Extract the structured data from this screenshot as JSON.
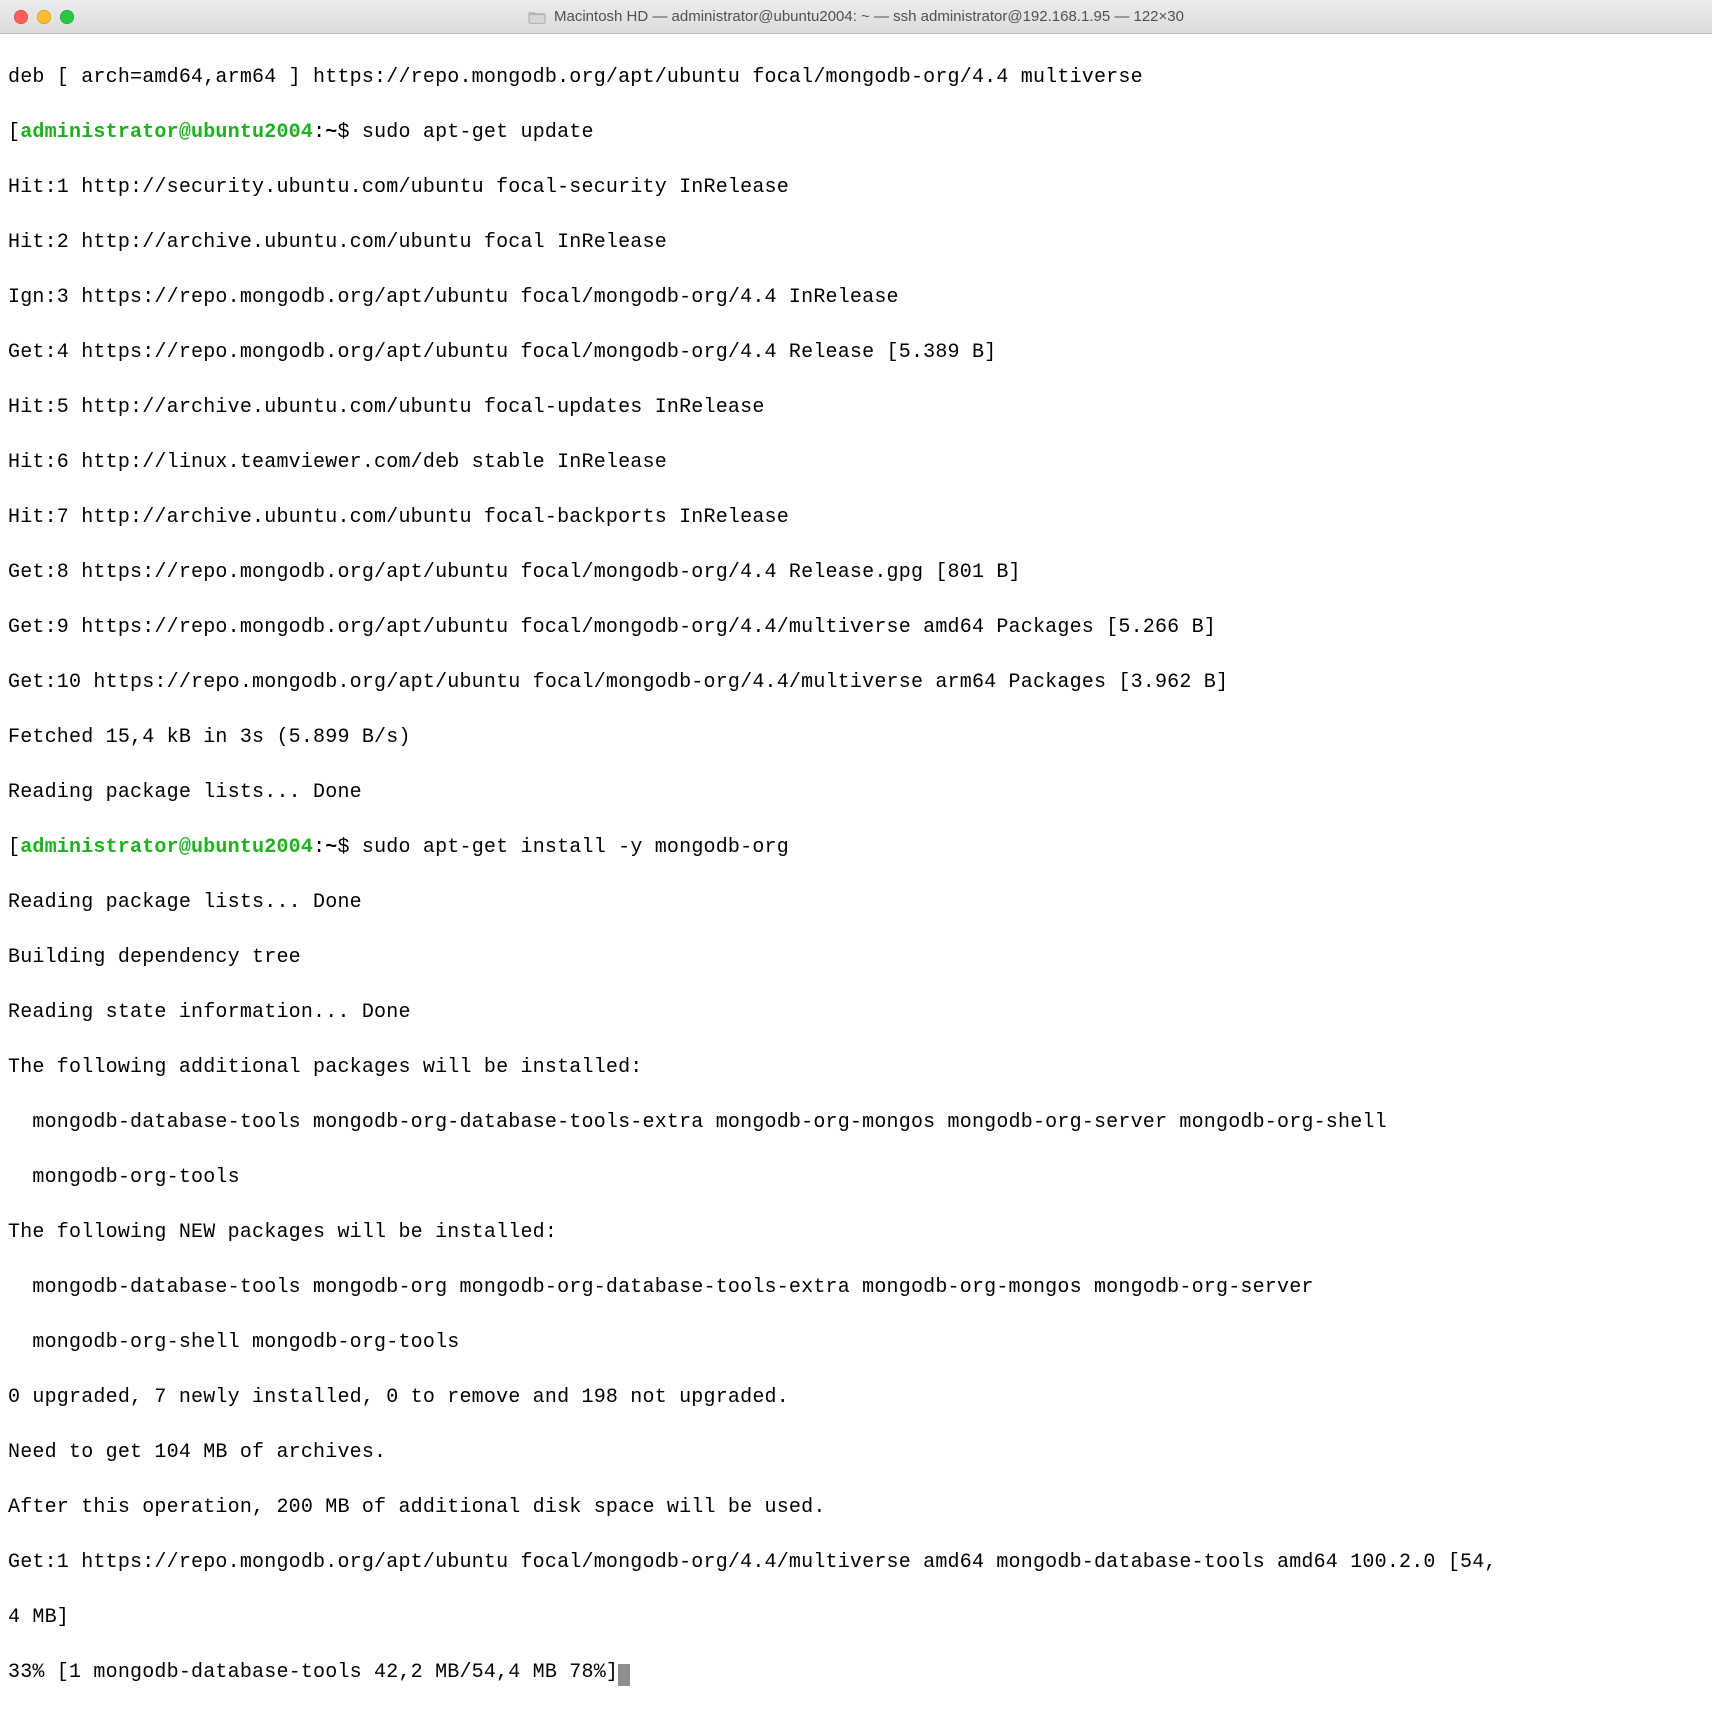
{
  "title": "Macintosh HD — administrator@ubuntu2004: ~ — ssh administrator@192.168.1.95 — 122×30",
  "prompt_user_host": "administrator@ubuntu2004",
  "prompt_sep": ":",
  "prompt_path": "~",
  "prompt_dollar": "$ ",
  "deb_line": "deb [ arch=amd64,arm64 ] https://repo.mongodb.org/apt/ubuntu focal/mongodb-org/4.4 multiverse",
  "cmd_update": "sudo apt-get update",
  "update_lines": [
    "Hit:1 http://security.ubuntu.com/ubuntu focal-security InRelease",
    "Hit:2 http://archive.ubuntu.com/ubuntu focal InRelease",
    "Ign:3 https://repo.mongodb.org/apt/ubuntu focal/mongodb-org/4.4 InRelease",
    "Get:4 https://repo.mongodb.org/apt/ubuntu focal/mongodb-org/4.4 Release [5.389 B]",
    "Hit:5 http://archive.ubuntu.com/ubuntu focal-updates InRelease",
    "Hit:6 http://linux.teamviewer.com/deb stable InRelease",
    "Hit:7 http://archive.ubuntu.com/ubuntu focal-backports InRelease",
    "Get:8 https://repo.mongodb.org/apt/ubuntu focal/mongodb-org/4.4 Release.gpg [801 B]",
    "Get:9 https://repo.mongodb.org/apt/ubuntu focal/mongodb-org/4.4/multiverse amd64 Packages [5.266 B]",
    "Get:10 https://repo.mongodb.org/apt/ubuntu focal/mongodb-org/4.4/multiverse arm64 Packages [3.962 B]",
    "Fetched 15,4 kB in 3s (5.899 B/s)",
    "Reading package lists... Done"
  ],
  "cmd_install": "sudo apt-get install -y mongodb-org",
  "install_lines": [
    "Reading package lists... Done",
    "Building dependency tree",
    "Reading state information... Done",
    "The following additional packages will be installed:",
    "  mongodb-database-tools mongodb-org-database-tools-extra mongodb-org-mongos mongodb-org-server mongodb-org-shell",
    "  mongodb-org-tools",
    "The following NEW packages will be installed:",
    "  mongodb-database-tools mongodb-org mongodb-org-database-tools-extra mongodb-org-mongos mongodb-org-server",
    "  mongodb-org-shell mongodb-org-tools",
    "0 upgraded, 7 newly installed, 0 to remove and 198 not upgraded.",
    "Need to get 104 MB of archives.",
    "After this operation, 200 MB of additional disk space will be used.",
    "Get:1 https://repo.mongodb.org/apt/ubuntu focal/mongodb-org/4.4/multiverse amd64 mongodb-database-tools amd64 100.2.0 [54,",
    "4 MB]"
  ],
  "progress_line": "33% [1 mongodb-database-tools 42,2 MB/54,4 MB 78%]"
}
